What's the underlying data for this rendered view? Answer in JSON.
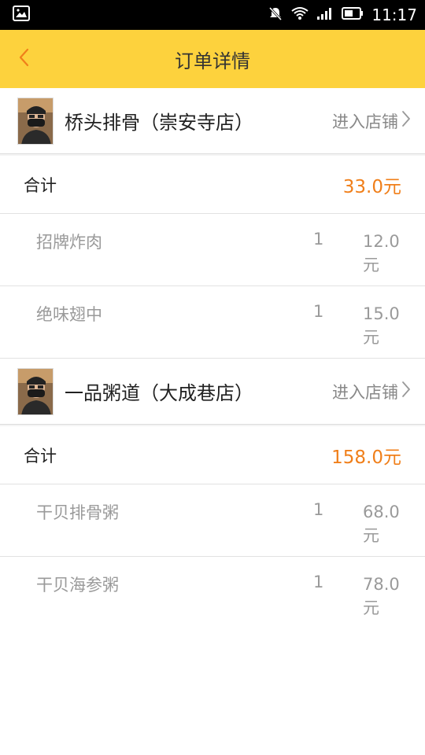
{
  "status_bar": {
    "time": "11:17"
  },
  "header": {
    "title": "订单详情"
  },
  "orders": [
    {
      "shop_name": "桥头排骨（崇安寺店）",
      "enter_label": "进入店铺",
      "total_label": "合计",
      "total_amount": "33.0元",
      "items": [
        {
          "name": "招牌炸肉",
          "qty": "1",
          "price": "12.0元"
        },
        {
          "name": "绝味翅中",
          "qty": "1",
          "price": "15.0元"
        }
      ]
    },
    {
      "shop_name": "一品粥道（大成巷店）",
      "enter_label": "进入店铺",
      "total_label": "合计",
      "total_amount": "158.0元",
      "items": [
        {
          "name": "干贝排骨粥",
          "qty": "1",
          "price": "68.0元"
        },
        {
          "name": "干贝海参粥",
          "qty": "1",
          "price": "78.0元"
        }
      ]
    }
  ],
  "colors": {
    "header_bg": "#fdd23d",
    "accent": "#f07f1a",
    "back_arrow": "#f07f1a"
  }
}
